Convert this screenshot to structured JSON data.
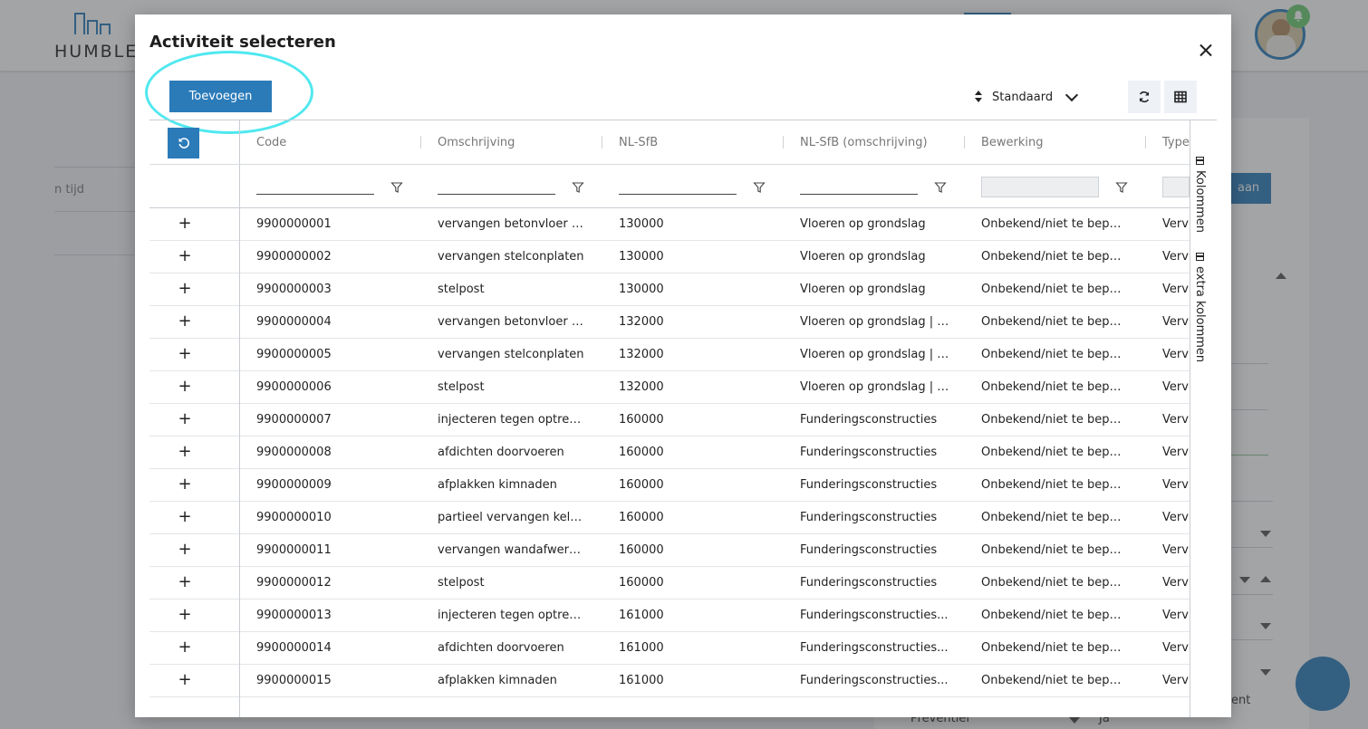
{
  "background": {
    "logo_text": "HUMBLE",
    "left_field_text": "n tijd",
    "right_button_label": "aan",
    "bottom_left_text": "Preventief",
    "bottom_mid_text": "Ja",
    "bottom_right_text": "ent"
  },
  "modal": {
    "title": "Activiteit selecteren",
    "add_button_label": "Toevoegen",
    "sort_label": "Standaard"
  },
  "grid": {
    "columns": [
      "Code",
      "Omschrijving",
      "NL-SfB",
      "NL-SfB (omschrijving)",
      "Bewerking",
      "Type"
    ],
    "side_panel": [
      "Kolommen",
      "extra kolommen"
    ],
    "rows": [
      [
        "9900000001",
        "vervangen betonvloer o...",
        "130000",
        "Vloeren op grondslag",
        "Onbekend/niet te bepal...",
        "Verv"
      ],
      [
        "9900000002",
        "vervangen stelconplaten",
        "130000",
        "Vloeren op grondslag",
        "Onbekend/niet te bepal...",
        "Verv"
      ],
      [
        "9900000003",
        "stelpost",
        "130000",
        "Vloeren op grondslag",
        "Onbekend/niet te bepal...",
        "Verv"
      ],
      [
        "9900000004",
        "vervangen betonvloer o...",
        "132000",
        "Vloeren op grondslag | c...",
        "Onbekend/niet te bepal...",
        "Verv"
      ],
      [
        "9900000005",
        "vervangen stelconplaten",
        "132000",
        "Vloeren op grondslag | c...",
        "Onbekend/niet te bepal...",
        "Verv"
      ],
      [
        "9900000006",
        "stelpost",
        "132000",
        "Vloeren op grondslag | c...",
        "Onbekend/niet te bepal...",
        "Verv"
      ],
      [
        "9900000007",
        "injecteren tegen optrek...",
        "160000",
        "Funderingsconstructies",
        "Onbekend/niet te bepal...",
        "Verv"
      ],
      [
        "9900000008",
        "afdichten doorvoeren",
        "160000",
        "Funderingsconstructies",
        "Onbekend/niet te bepal...",
        "Verv"
      ],
      [
        "9900000009",
        "afplakken kimnaden",
        "160000",
        "Funderingsconstructies",
        "Onbekend/niet te bepal...",
        "Verv"
      ],
      [
        "9900000010",
        "partieel vervangen keld...",
        "160000",
        "Funderingsconstructies",
        "Onbekend/niet te bepal...",
        "Verv"
      ],
      [
        "9900000011",
        "vervangen wandafwerki...",
        "160000",
        "Funderingsconstructies",
        "Onbekend/niet te bepal...",
        "Verv"
      ],
      [
        "9900000012",
        "stelpost",
        "160000",
        "Funderingsconstructies",
        "Onbekend/niet te bepal...",
        "Verv"
      ],
      [
        "9900000013",
        "injecteren tegen optrek...",
        "161000",
        "Funderingsconstructies...",
        "Onbekend/niet te bepal...",
        "Verv"
      ],
      [
        "9900000014",
        "afdichten doorvoeren",
        "161000",
        "Funderingsconstructies...",
        "Onbekend/niet te bepal...",
        "Verv"
      ],
      [
        "9900000015",
        "afplakken kimnaden",
        "161000",
        "Funderingsconstructies...",
        "Onbekend/niet te bepal...",
        "Verv"
      ]
    ]
  },
  "colors": {
    "accent": "#2b7bb9",
    "highlight_ring": "#4fe8ef",
    "notification": "#6ccb70"
  },
  "icons": {
    "close": "close-icon",
    "sort": "sort-icon",
    "refresh": "refresh-icon",
    "grid": "grid-icon",
    "reset": "reset-icon",
    "filter": "filter-icon",
    "add_row": "plus-icon",
    "bell": "bell-icon"
  }
}
